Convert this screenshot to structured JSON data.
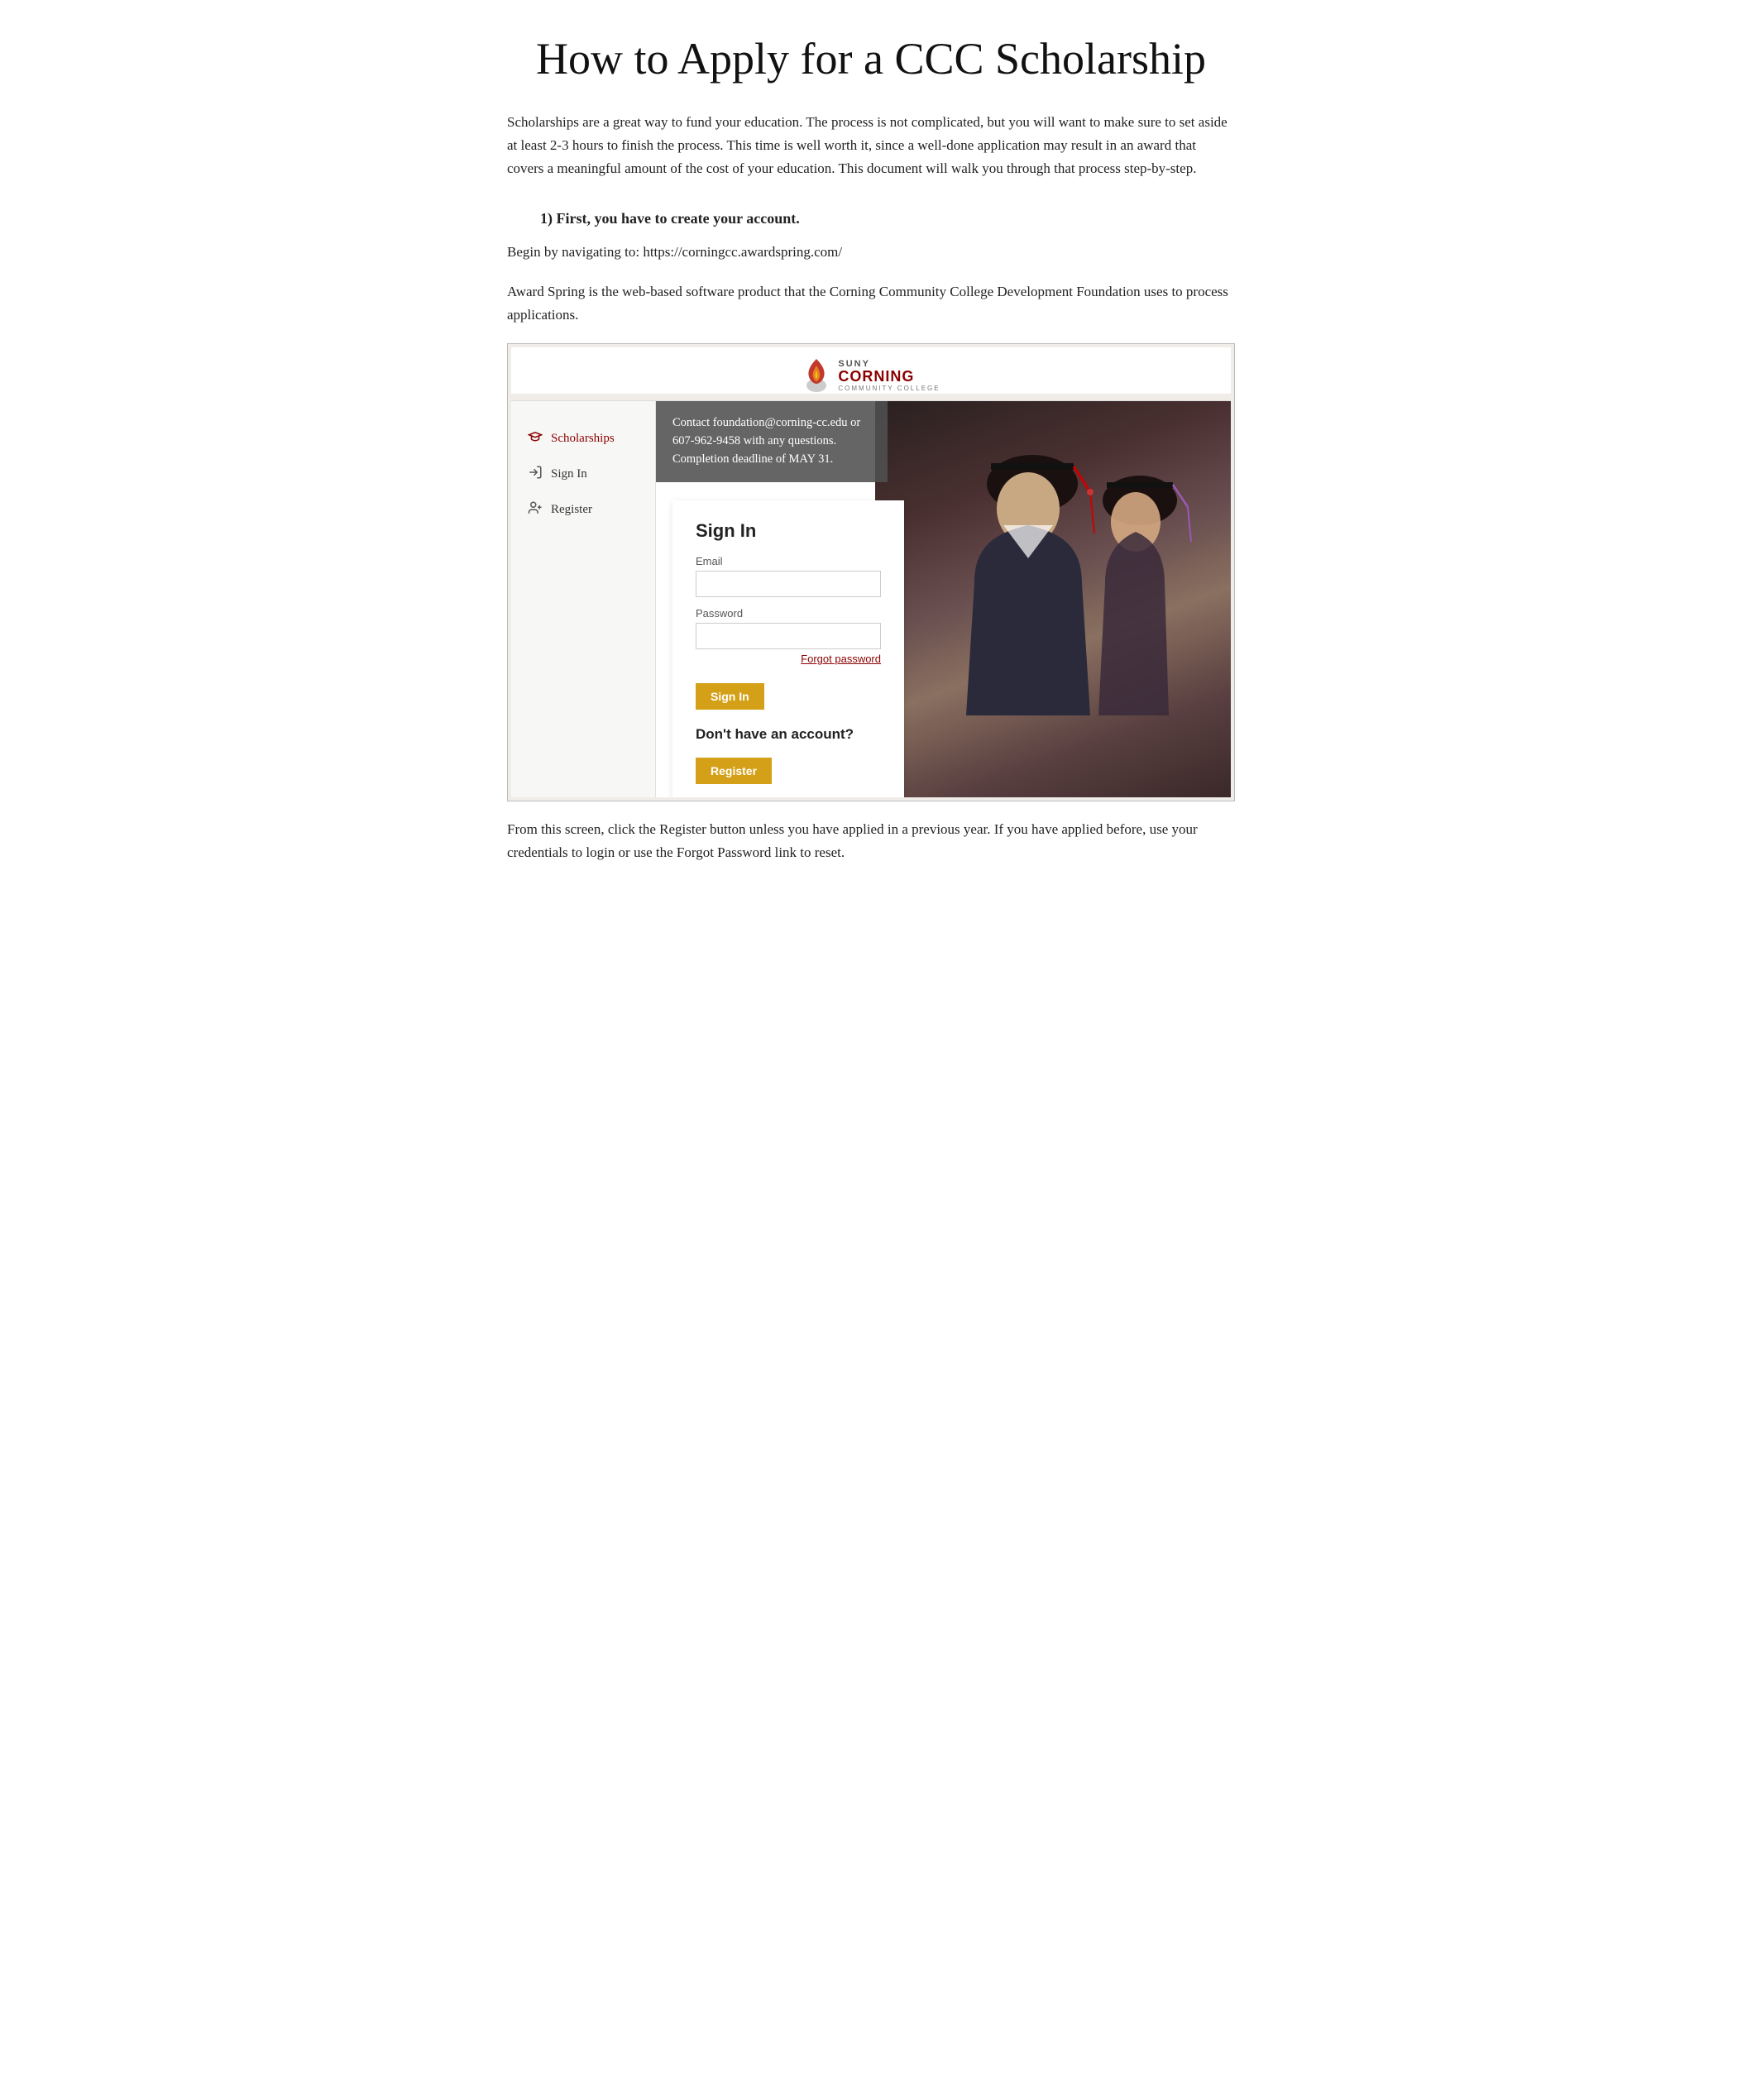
{
  "page": {
    "title": "How to Apply for a CCC Scholarship",
    "intro": "Scholarships are a great way to fund your education. The process is not complicated, but you will want to make sure to set aside at least 2-3 hours to finish the process. This time is well worth it, since a well-done application may result in an award that covers a meaningful amount of the cost of your education. This document will walk you through that process step-by-step.",
    "step1_heading": "1) First, you have to create your account.",
    "step1_navigate": "Begin by navigating to: https://corningcc.awardspring.com/",
    "step1_description": "Award Spring is the web-based software product that the Corning Community College Development Foundation uses to process applications.",
    "footer_text": "From this screen, click the Register button unless you have applied in a previous year. If you have applied before, use your credentials to login or use the Forgot Password link to reset."
  },
  "logo": {
    "suny": "SUNY",
    "corning": "CORNING",
    "community": "COMMUNITY COLLEGE"
  },
  "sidebar": {
    "items": [
      {
        "label": "Scholarships",
        "icon": "🎓"
      },
      {
        "label": "Sign In",
        "icon": "→"
      },
      {
        "label": "Register",
        "icon": "👤+"
      }
    ]
  },
  "notification": {
    "text": "Contact foundation@corning-cc.edu or 607-962-9458 with any questions. Completion deadline of MAY 31."
  },
  "sign_in_form": {
    "title": "Sign In",
    "email_label": "Email",
    "password_label": "Password",
    "forgot_password": "Forgot password",
    "sign_in_button": "Sign In",
    "no_account_heading": "Don't have an account?",
    "register_button": "Register"
  }
}
